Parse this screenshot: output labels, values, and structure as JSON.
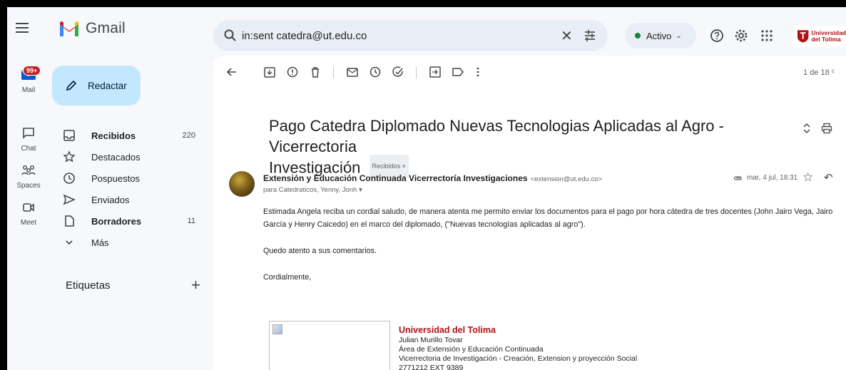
{
  "app": {
    "title": "Gmail"
  },
  "search": {
    "value": "in:sent catedra@ut.edu.co"
  },
  "status": {
    "label": "Activo"
  },
  "brand": {
    "line1": "Universidad",
    "line2": "del Tolima"
  },
  "rail": {
    "mail_badge": "99+",
    "items": [
      {
        "label": "Mail",
        "icon": "mail-icon"
      },
      {
        "label": "Chat",
        "icon": "chat-icon"
      },
      {
        "label": "Spaces",
        "icon": "spaces-icon"
      },
      {
        "label": "Meet",
        "icon": "meet-icon"
      }
    ]
  },
  "nav": {
    "compose": "Redactar",
    "items": [
      {
        "label": "Recibidos",
        "count": "220",
        "bold": true,
        "icon": "inbox-icon"
      },
      {
        "label": "Destacados",
        "count": "",
        "bold": false,
        "icon": "star-icon"
      },
      {
        "label": "Pospuestos",
        "count": "",
        "bold": false,
        "icon": "clock-icon"
      },
      {
        "label": "Enviados",
        "count": "",
        "bold": false,
        "icon": "send-icon"
      },
      {
        "label": "Borradores",
        "count": "11",
        "bold": true,
        "icon": "draft-icon"
      },
      {
        "label": "Más",
        "count": "",
        "bold": false,
        "icon": "chevron-down-icon"
      }
    ],
    "labels_heading": "Etiquetas"
  },
  "toolbar": {
    "pagination": "1 de 18"
  },
  "message": {
    "subject_line1": "Pago Catedra Diplomado Nuevas Tecnologias Aplicadas al Agro - Vicerrectoria",
    "subject_line2": "Investigación",
    "chip": "Recibidos ×",
    "sender_name": "Extensión y Educación Continuada Vicerrectoría Investigaciones",
    "sender_email": "<extension@ut.edu.co>",
    "recipients": "para Catedraticos, Yenny, Jonh ▾",
    "date": "mar, 4 jul, 18:31",
    "body": [
      "Estimada Angela reciba un cordial saludo, de manera atenta me permito enviar los documentos para el pago por hora cátedra de tres docentes (John Jairo Vega, Jairo García y Henry Caicedo) en el marco del diplomado,  (\"Nuevas tecnologías aplicadas al agro\").",
      "Quedo atento a sus comentarios.",
      "Cordialmente,"
    ],
    "signature": {
      "org": "Universidad del Tolima",
      "name": "Julian Murillo Tovar",
      "area": "Área de Extensión y Educación Continuada",
      "dept": "Vicerrectoria de Investigación - Creación, Extension y proyección Social",
      "phone": "2771212 EXT 9389"
    }
  },
  "colors": {
    "accent": "#0b57d0",
    "compose_bg": "#c2e7ff",
    "brand_red": "#b11116",
    "active_green": "#188038"
  }
}
